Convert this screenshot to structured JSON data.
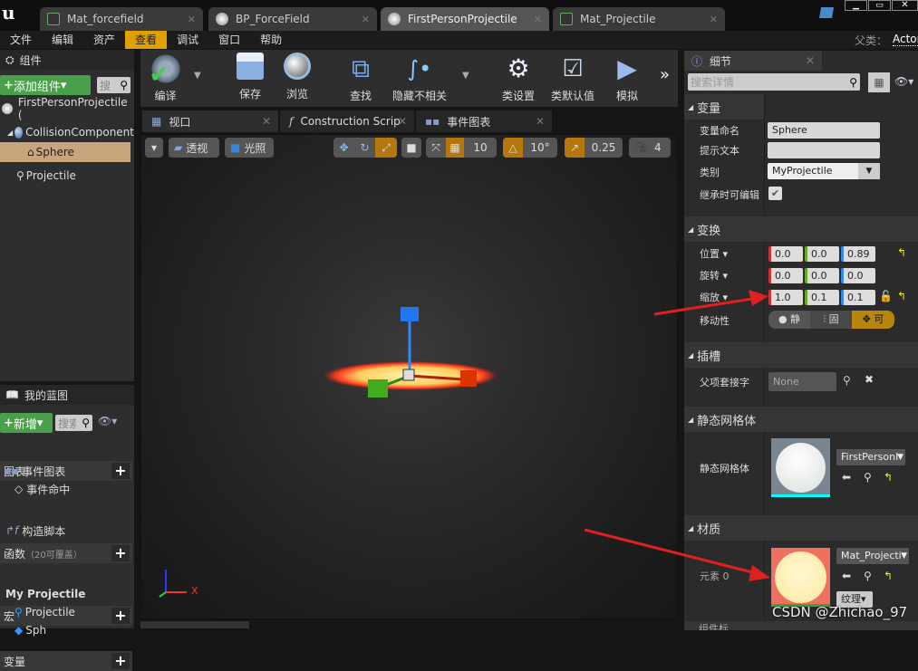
{
  "tabs": [
    {
      "label": "Mat_forcefield",
      "icon": "material-icon"
    },
    {
      "label": "BP_ForceField",
      "icon": "blueprint-icon"
    },
    {
      "label": "FirstPersonProjectile",
      "icon": "blueprint-icon",
      "active": true
    },
    {
      "label": "Mat_Projectile",
      "icon": "material-icon"
    }
  ],
  "menu": [
    "文件",
    "编辑",
    "资产",
    "查看",
    "调试",
    "窗口",
    "帮助"
  ],
  "active_menu": "查看",
  "parent_class": {
    "label": "父类：",
    "value": "Actor"
  },
  "components": {
    "title": "组件",
    "add_label": "添加组件",
    "search_placeholder": "搜",
    "tree": [
      "FirstPersonProjectile (",
      "CollisionComponent",
      "Sphere",
      "Projectile"
    ]
  },
  "toolbar": [
    "编译",
    "保存",
    "浏览",
    "查找",
    "隐藏不相关",
    "类设置",
    "类默认值",
    "模拟"
  ],
  "editor_tabs": [
    "视口",
    "Construction Scrip",
    "事件图表"
  ],
  "viewport": {
    "perspective": "透视",
    "lit": "光照",
    "grid": "10",
    "rotation": "10°",
    "scale": "0.25",
    "camera_speed": "4",
    "axis_x": "X"
  },
  "my_blueprint": {
    "title": "我的蓝图",
    "new_label": "新增",
    "search_placeholder": "搜索",
    "graphs": "图表",
    "event_graph": "事件图表",
    "event_hit": "事件命中",
    "functions": "函数",
    "functions_note": "（20可覆盖）",
    "construction": "构造脚本",
    "macros": "宏",
    "variables": "变量",
    "var_category": "My Projectile",
    "var_items": [
      "Projectile",
      "Sph"
    ]
  },
  "details": {
    "title": "细节",
    "search_placeholder": "搜索详情",
    "variable": {
      "section": "变量",
      "name_label": "变量命名",
      "name_value": "Sphere",
      "tooltip_label": "提示文本",
      "tooltip_value": "",
      "category_label": "类别",
      "category_value": "MyProjectile",
      "editable_label": "继承时可编辑"
    },
    "transform": {
      "section": "变换",
      "location_label": "位置",
      "location": [
        "0.0",
        "0.0",
        "0.89"
      ],
      "rotation_label": "旋转",
      "rotation": [
        "0.0",
        "0.0",
        "0.0"
      ],
      "scale_label": "缩放",
      "scale": [
        "1.0",
        "0.1",
        "0.1"
      ],
      "mobility_label": "移动性",
      "mobility": [
        "静",
        "固",
        "可"
      ]
    },
    "sockets": {
      "section": "插槽",
      "parent_socket_label": "父项套接字",
      "parent_socket_value": "None"
    },
    "static_mesh": {
      "section": "静态网格体",
      "label": "静态网格体",
      "value": "FirstPersonI"
    },
    "materials": {
      "section": "材质",
      "element_label": "元素 0",
      "value": "Mat_Projecti",
      "texture_label": "纹理"
    },
    "next_section": "组件标"
  },
  "watermark": "CSDN @Zhichao_97",
  "colors": {
    "accent": "#e0a000",
    "green": "#4aa04a"
  }
}
